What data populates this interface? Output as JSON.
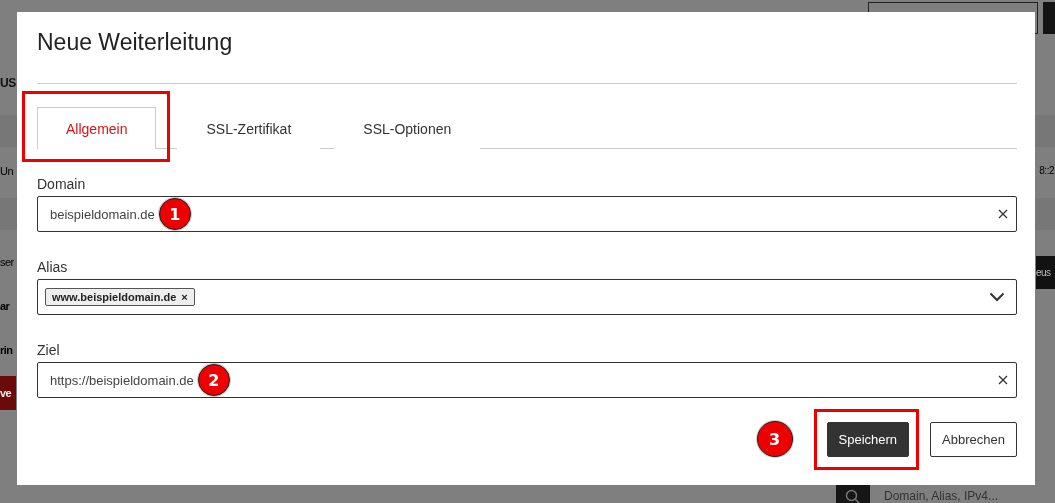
{
  "background": {
    "heading": "US",
    "texts": [
      "Un",
      "ser",
      "ar",
      "rin"
    ],
    "danger_button": "ve",
    "right_text": "8::2",
    "dark_button": "eus",
    "search": {
      "placeholder": "Domain, Alias, IPv4..."
    }
  },
  "dialog": {
    "title": "Neue Weiterleitung",
    "tabs": [
      {
        "label": "Allgemein",
        "selected": true,
        "highlighted": true
      },
      {
        "label": "SSL-Zertifikat",
        "selected": false,
        "highlighted": false
      },
      {
        "label": "SSL-Optionen",
        "selected": false,
        "highlighted": false
      }
    ],
    "fields": [
      {
        "kind": "text",
        "label": "Domain",
        "value": "beispieldomain.de",
        "step": "1"
      },
      {
        "kind": "tags",
        "label": "Alias",
        "tags": [
          {
            "label": "www.beispieldomain.de",
            "remove": "×"
          }
        ]
      },
      {
        "kind": "text",
        "label": "Ziel",
        "value": "https://beispieldomain.de",
        "step": "2"
      }
    ],
    "step": "3",
    "buttons": [
      {
        "label": "Speichern",
        "kind": "primary",
        "highlighted": true
      },
      {
        "label": "Abbrechen",
        "kind": "secondary",
        "highlighted": false
      }
    ]
  }
}
